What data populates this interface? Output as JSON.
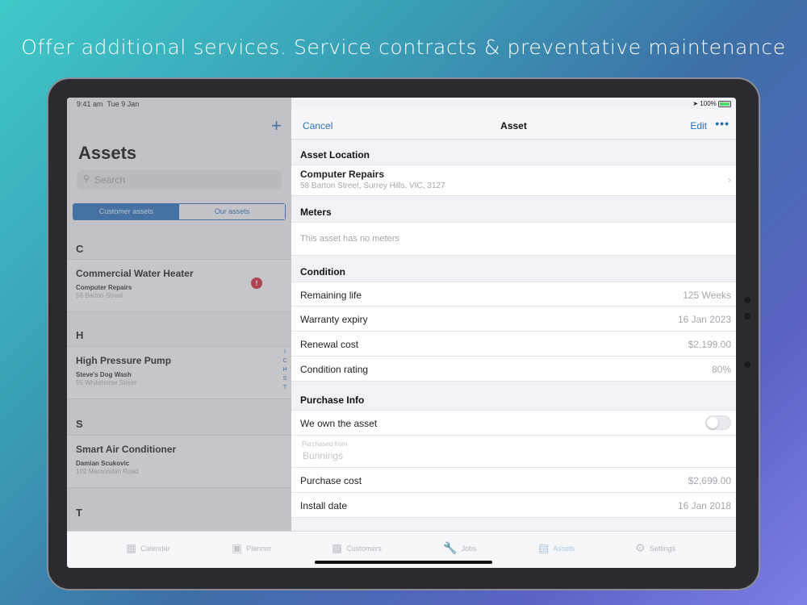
{
  "headline": "Offer additional services. Service contracts & preventative maintenance",
  "status": {
    "time": "9:41 am",
    "date": "Tue 9 Jan",
    "battery": "100%",
    "battery_color": "#4cd964"
  },
  "left": {
    "title": "Assets",
    "search_placeholder": "Search",
    "segments": [
      "Customer assets",
      "Our assets"
    ],
    "sections": [
      {
        "letter": "C",
        "items": [
          {
            "name": "Commercial Water Heater",
            "customer": "Computer Repairs",
            "address": "58 Barton Street",
            "alert": "!"
          }
        ]
      },
      {
        "letter": "H",
        "items": [
          {
            "name": "High Pressure Pump",
            "customer": "Steve's Dog Wash",
            "address": "55 Whitehorse Street"
          }
        ]
      },
      {
        "letter": "S",
        "items": [
          {
            "name": "Smart Air Conditioner",
            "customer": "Damian Scukovic",
            "address": "102 Maroondah Road"
          }
        ]
      },
      {
        "letter": "T",
        "items": []
      }
    ],
    "index": [
      "I",
      "C",
      "H",
      "S",
      "T"
    ]
  },
  "detail": {
    "nav": {
      "cancel": "Cancel",
      "title": "Asset",
      "edit": "Edit",
      "more": "•••"
    },
    "location": {
      "header": "Asset Location",
      "name": "Computer Repairs",
      "address": "58 Barton Street, Surrey Hills, VIC, 3127"
    },
    "meters": {
      "header": "Meters",
      "empty": "This asset has no meters"
    },
    "condition": {
      "header": "Condition",
      "rows": [
        {
          "label": "Remaining life",
          "value": "125 Weeks"
        },
        {
          "label": "Warranty expiry",
          "value": "16 Jan 2023"
        },
        {
          "label": "Renewal cost",
          "value": "$2,199.00"
        },
        {
          "label": "Condition rating",
          "value": "80%"
        }
      ]
    },
    "purchase": {
      "header": "Purchase Info",
      "own_label": "We own the asset",
      "own_value": false,
      "purchased_from_label": "Purchased from",
      "purchased_from_value": "Bunnings",
      "cost_label": "Purchase cost",
      "cost_value": "$2,699.00",
      "install_label": "Install date",
      "install_value": "16 Jan 2018"
    }
  },
  "tabs": [
    {
      "label": "Calendar",
      "icon": "calendar-icon",
      "active": false
    },
    {
      "label": "Planner",
      "icon": "planner-icon",
      "active": false
    },
    {
      "label": "Customers",
      "icon": "customers-icon",
      "active": false
    },
    {
      "label": "Jobs",
      "icon": "wrench-icon",
      "active": false
    },
    {
      "label": "Assets",
      "icon": "assets-icon",
      "active": true
    },
    {
      "label": "Settings",
      "icon": "gear-icon",
      "active": false
    }
  ]
}
